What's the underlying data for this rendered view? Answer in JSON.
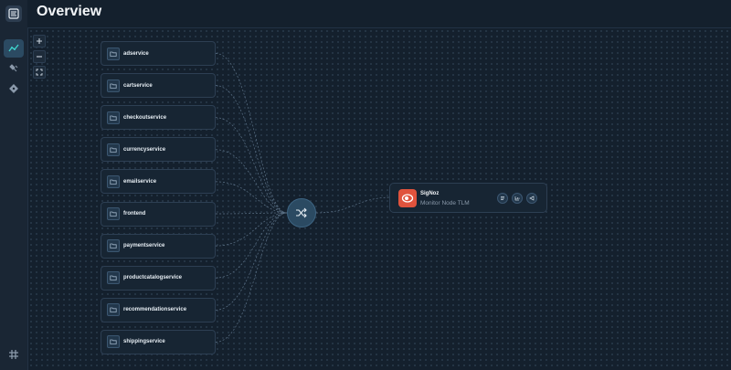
{
  "header": {
    "title": "Overview"
  },
  "sidebar": {
    "items": [
      {
        "name": "pipelines",
        "icon": "pipeline-icon",
        "active": true
      },
      {
        "name": "integrations",
        "icon": "plug-icon",
        "active": false
      },
      {
        "name": "git",
        "icon": "git-icon",
        "active": false
      }
    ],
    "bottom_icon": "settings-grid-icon"
  },
  "canvas": {
    "controls": [
      "zoom-in",
      "zoom-out",
      "fit-view"
    ],
    "sources": [
      "adservice",
      "cartservice",
      "checkoutservice",
      "currencyservice",
      "emailservice",
      "frontend",
      "paymentservice",
      "productcatalogservice",
      "recommendationservice",
      "shippingservice"
    ],
    "hub_icon": "shuffle-icon",
    "destination": {
      "name": "SigNoz",
      "subtitle": "Monitor Node TLM",
      "brand_color": "#e0533d",
      "actions": [
        "logs-icon",
        "metrics-icon",
        "traces-icon"
      ]
    }
  },
  "colors": {
    "accent": "#2b4a62",
    "brand": "#e0533d"
  }
}
